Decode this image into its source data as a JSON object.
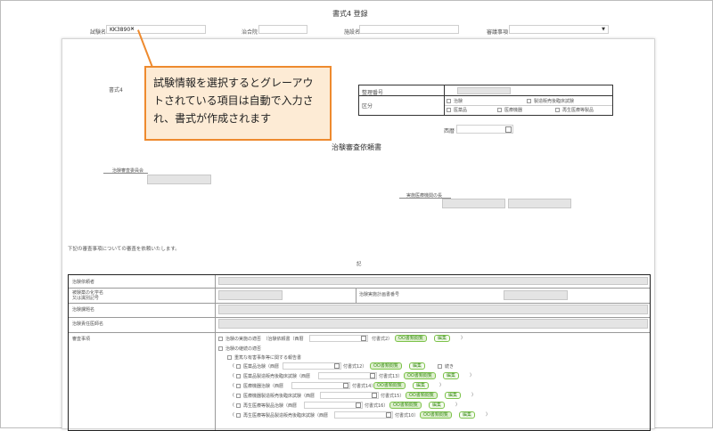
{
  "header": {
    "title": "書式4 登録",
    "exam_label": "試験名",
    "exam_value": "KK3890",
    "clear_icon": "×",
    "committee_label": "治合院",
    "facility_label": "施設名",
    "review_label": "審議事項"
  },
  "callout": {
    "text": "試験情報を選択するとグレーアウトされている項目は自動で入力され、書式が作成されます"
  },
  "paper": {
    "form_no": "書式4",
    "ref_label": "整理番号",
    "category_label": "区分",
    "opt_trial": "治験",
    "opt_post": "製造販売後臨床試験",
    "opt_drug": "医薬品",
    "opt_device": "医療機器",
    "opt_regen": "再生医療等製品",
    "date_label": "西暦",
    "doc_title": "治験審査依頼書",
    "irb_label": "治験審査委員会",
    "head_label": "実施医療機関の長",
    "intro": "下記の審査事項についての審査を依頼いたします。",
    "ki": "記"
  },
  "table": {
    "requester": "治験依頼者",
    "drug_name": "被験薬の化学名\n又は識別記号",
    "protocol_no": "治験実施計画書番号",
    "subject": "治験課題名",
    "investigator": "治験責任医師名",
    "review_items": "審査事項",
    "row1": "治験の実施の適否　（治験依頼書（西暦",
    "row1_suffix": "付書式2）",
    "row2": "治験の継続の適否",
    "row3": "重篤な有害事象等に関する報告書",
    "row4": "医薬品治験（西暦",
    "row4_suffix": "付書式12）",
    "row4_extra": "続き",
    "row5": "医薬品製造販売後臨床試験（西暦",
    "row5_suffix": "付書式13）",
    "row6": "医療機器治験（西暦",
    "row6_suffix": "付書式14）",
    "row7": "医療機器製造販売後臨床試験（西暦",
    "row7_suffix": "付書式15）",
    "row8": "再生医療等製品治験（西暦",
    "row8_suffix": "付書式16）",
    "row9": "再生医療等製品製造販売後臨床試験（西暦",
    "row9_suffix": "付書式10）",
    "tag_doc": "OO書類閲覧",
    "tag_edit": "編集",
    "close_paren": "）"
  },
  "colors": {
    "accent": "#ee8a2e",
    "callout_bg": "#fdebd5",
    "tag_green": "#7cc24a"
  }
}
